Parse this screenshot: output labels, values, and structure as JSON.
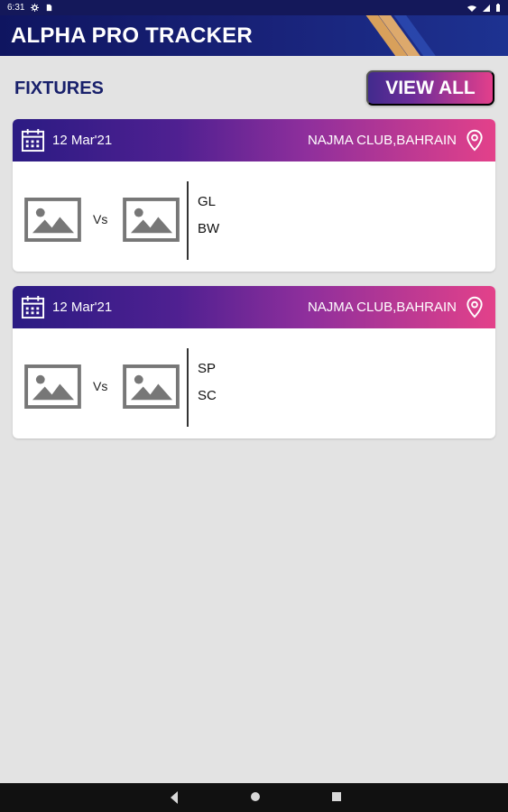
{
  "status_bar": {
    "time": "6:31",
    "icons": [
      "gear-icon",
      "file-icon",
      "wifi-icon",
      "signal-icon",
      "battery-icon"
    ]
  },
  "app": {
    "title": "ALPHA PRO TRACKER"
  },
  "fixtures": {
    "section_title": "FIXTURES",
    "view_all_label": "VIEW ALL",
    "cards": [
      {
        "date": "12 Mar'21",
        "venue": "NAJMA CLUB,BAHRAIN",
        "vs_label": "Vs",
        "team_codes": [
          "GL",
          "BW"
        ]
      },
      {
        "date": "12 Mar'21",
        "venue": "NAJMA CLUB,BAHRAIN",
        "vs_label": "Vs",
        "team_codes": [
          "SP",
          "SC"
        ]
      }
    ]
  },
  "colors": {
    "app_bar": "#14185a",
    "accent_purple": "#4f2091",
    "accent_pink": "#e3418a",
    "background": "#e3e3e3"
  },
  "navigation": {
    "icons": [
      "back-icon",
      "home-icon",
      "recent-apps-icon"
    ]
  }
}
